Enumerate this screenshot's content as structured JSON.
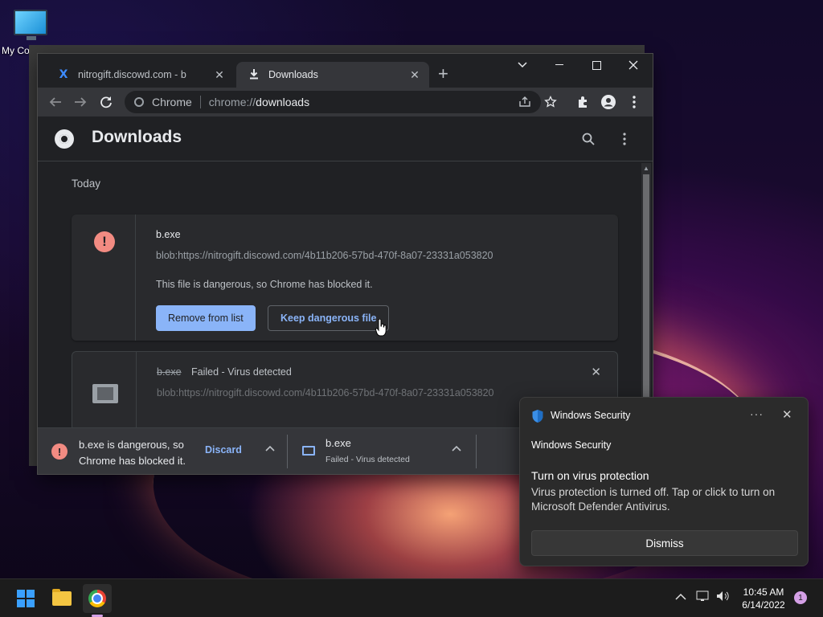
{
  "desktop": {
    "icon_label": "My Computer"
  },
  "chrome": {
    "tabs": [
      {
        "title": "nitrogift.discowd.com - b",
        "favicon": "X"
      },
      {
        "title": "Downloads"
      }
    ],
    "new_tab": "+",
    "omnibox": {
      "chip_label": "Chrome",
      "url_scheme": "chrome://",
      "url_host": "downloads"
    },
    "page": {
      "title": "Downloads",
      "date_group": "Today",
      "items": [
        {
          "filename": "b.exe",
          "url": "blob:https://nitrogift.discowd.com/4b11b206-57bd-470f-8a07-23331a053820",
          "description": "This file is dangerous, so Chrome has blocked it.",
          "button_remove": "Remove from list",
          "button_keep": "Keep dangerous file"
        },
        {
          "filename": "b.exe",
          "status": "Failed - Virus detected",
          "url": "blob:https://nitrogift.discowd.com/4b11b206-57bd-470f-8a07-23331a053820"
        }
      ]
    },
    "shelf": {
      "item1_text": "b.exe is dangerous, so Chrome has blocked it.",
      "item1_action": "Discard",
      "item2_name": "b.exe",
      "item2_status": "Failed - Virus detected"
    }
  },
  "toast": {
    "app_name": "Windows Security",
    "more": "···",
    "subtitle": "Windows Security",
    "title": "Turn on virus protection",
    "body": "Virus protection is turned off. Tap or click to turn on Microsoft Defender Antivirus.",
    "button": "Dismiss"
  },
  "taskbar": {
    "time": "10:45 AM",
    "date": "6/14/2022",
    "notification_count": "1"
  },
  "colors": {
    "accent": "#8ab4f8",
    "danger": "#f28b82",
    "windows_blue": "#3aa0ff"
  }
}
